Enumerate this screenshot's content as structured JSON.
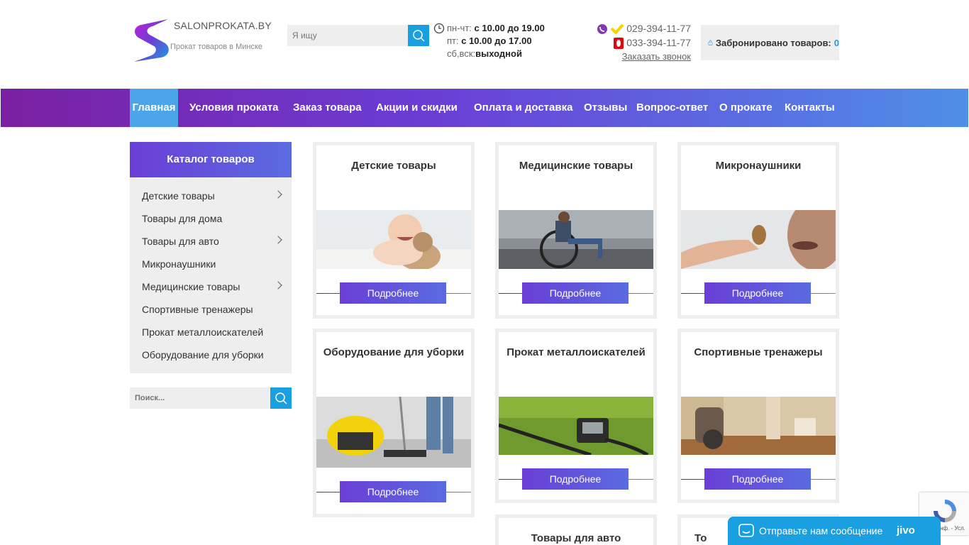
{
  "header": {
    "logo_name": "SALONPROKATA.BY",
    "logo_tagline": "Прокат товаров в Минске",
    "search_placeholder": "Я ищу",
    "hours": {
      "weekday_label": "пн-чт:",
      "weekday_value": "с 10.00 до 19.00",
      "friday_label": "пт:",
      "friday_value": "с 10.00 до 17.00",
      "weekend_label": "сб,вск:",
      "weekend_value": "выходной"
    },
    "phone_1": "029-394-11-77",
    "phone_2": "033-394-11-77",
    "callback": "Заказать звонок",
    "booked_label": "Забронировано товаров:",
    "booked_count": "0"
  },
  "nav": {
    "items": [
      "Главная",
      "Условия проката",
      "Заказ товара",
      "Акции и скидки",
      "Оплата и доставка",
      "Отзывы",
      "Вопрос-ответ",
      "О прокате",
      "Контакты"
    ]
  },
  "sidebar": {
    "title": "Каталог товаров",
    "items": [
      "Детские товары",
      "Товары для дома",
      "Товары для авто",
      "Микронаушники",
      "Медицинские товары",
      "Спортивные тренажеры",
      "Прокат металлоискателей",
      "Оборудование для уборки"
    ],
    "search_placeholder": "Поиск..."
  },
  "cards": [
    {
      "title": "Детские товары",
      "button": "Подробнее"
    },
    {
      "title": "Медицинские товары",
      "button": "Подробнее"
    },
    {
      "title": "Микронаушники",
      "button": "Подробнее"
    },
    {
      "title": "Оборудование для уборки",
      "button": "Подробнее"
    },
    {
      "title": "Прокат металлоискателей",
      "button": "Подробнее"
    },
    {
      "title": "Спортивные тренажеры",
      "button": "Подробнее"
    },
    {
      "title": "Товары для авто"
    },
    {
      "title": "То"
    }
  ],
  "widgets": {
    "chat_label": "Отправьте нам сообщение",
    "chat_brand": "jivo",
    "recaptcha_label": "Конф. - Усл."
  },
  "colors": {
    "accent_blue": "#1a9fe0",
    "nav_purple": "#7b1fa2",
    "nav_blue": "#4e8fe8"
  }
}
